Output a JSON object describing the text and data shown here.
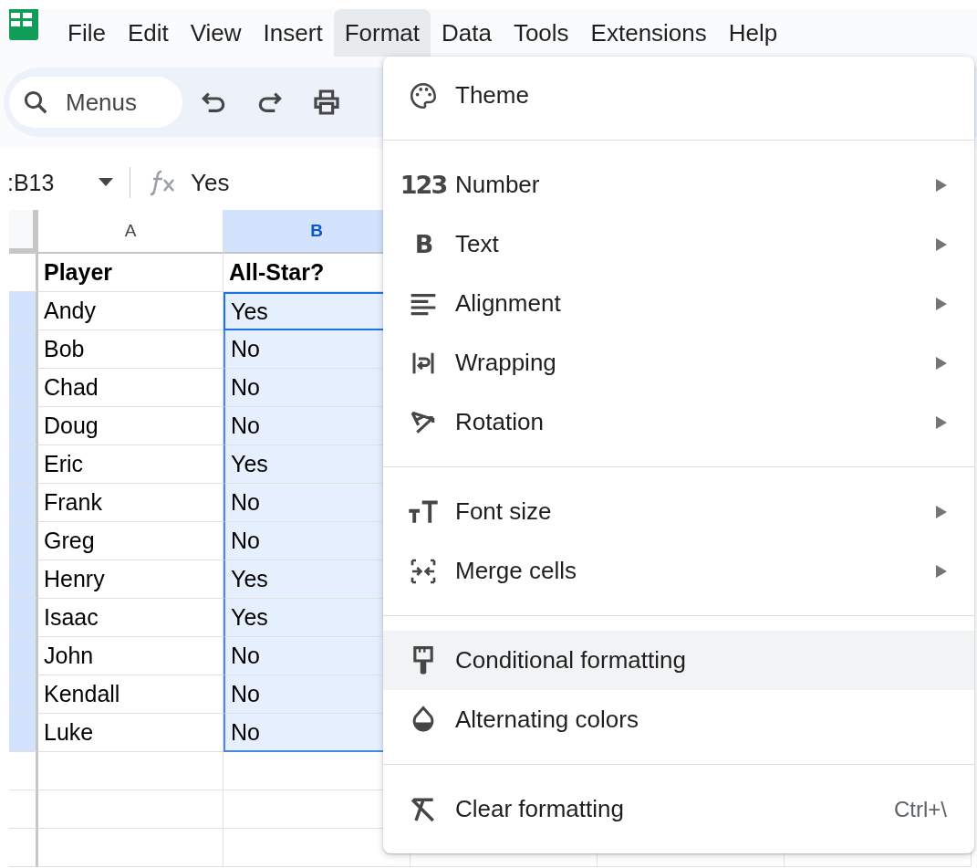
{
  "menubar": {
    "items": [
      {
        "label": "File",
        "selected": false
      },
      {
        "label": "Edit",
        "selected": false
      },
      {
        "label": "View",
        "selected": false
      },
      {
        "label": "Insert",
        "selected": false
      },
      {
        "label": "Format",
        "selected": true
      },
      {
        "label": "Data",
        "selected": false
      },
      {
        "label": "Tools",
        "selected": false
      },
      {
        "label": "Extensions",
        "selected": false
      },
      {
        "label": "Help",
        "selected": false
      }
    ]
  },
  "toolbar": {
    "search": {
      "placeholder": "Menus"
    }
  },
  "formula_bar": {
    "name_box": ":B13",
    "formula": "Yes"
  },
  "grid": {
    "columns": [
      {
        "label": "A",
        "selected": false
      },
      {
        "label": "B",
        "selected": true
      }
    ],
    "rows": [
      {
        "kind": "header",
        "selected": false,
        "active": false,
        "cells": [
          "Player",
          "All-Star?"
        ]
      },
      {
        "kind": "data",
        "selected": true,
        "active": true,
        "cells": [
          "Andy",
          "Yes"
        ]
      },
      {
        "kind": "data",
        "selected": true,
        "active": false,
        "cells": [
          "Bob",
          "No"
        ]
      },
      {
        "kind": "data",
        "selected": true,
        "active": false,
        "cells": [
          "Chad",
          "No"
        ]
      },
      {
        "kind": "data",
        "selected": true,
        "active": false,
        "cells": [
          "Doug",
          "No"
        ]
      },
      {
        "kind": "data",
        "selected": true,
        "active": false,
        "cells": [
          "Eric",
          "Yes"
        ]
      },
      {
        "kind": "data",
        "selected": true,
        "active": false,
        "cells": [
          "Frank",
          "No"
        ]
      },
      {
        "kind": "data",
        "selected": true,
        "active": false,
        "cells": [
          "Greg",
          "No"
        ]
      },
      {
        "kind": "data",
        "selected": true,
        "active": false,
        "cells": [
          "Henry",
          "Yes"
        ]
      },
      {
        "kind": "data",
        "selected": true,
        "active": false,
        "cells": [
          "Isaac",
          "Yes"
        ]
      },
      {
        "kind": "data",
        "selected": true,
        "active": false,
        "cells": [
          "John",
          "No"
        ]
      },
      {
        "kind": "data",
        "selected": true,
        "active": false,
        "cells": [
          "Kendall",
          "No"
        ]
      },
      {
        "kind": "data",
        "selected": true,
        "active": false,
        "cells": [
          "Luke",
          "No"
        ]
      }
    ]
  },
  "format_menu": {
    "items": [
      {
        "kind": "item",
        "label": "Theme",
        "submenu": false,
        "selected": false
      },
      {
        "kind": "separator"
      },
      {
        "kind": "item",
        "label": "Number",
        "glyph": "123",
        "submenu": true,
        "selected": false
      },
      {
        "kind": "item",
        "label": "Text",
        "glyph": "B",
        "submenu": true,
        "selected": false
      },
      {
        "kind": "item",
        "label": "Alignment",
        "submenu": true,
        "selected": false
      },
      {
        "kind": "item",
        "label": "Wrapping",
        "submenu": true,
        "selected": false
      },
      {
        "kind": "item",
        "label": "Rotation",
        "submenu": true,
        "selected": false
      },
      {
        "kind": "separator"
      },
      {
        "kind": "item",
        "label": "Font size",
        "submenu": true,
        "selected": false
      },
      {
        "kind": "item",
        "label": "Merge cells",
        "submenu": true,
        "selected": false
      },
      {
        "kind": "separator"
      },
      {
        "kind": "item",
        "label": "Conditional formatting",
        "submenu": false,
        "selected": true
      },
      {
        "kind": "item",
        "label": "Alternating colors",
        "submenu": false,
        "selected": false
      },
      {
        "kind": "separator"
      },
      {
        "kind": "item",
        "label": "Clear formatting",
        "submenu": false,
        "selected": false,
        "shortcut": "Ctrl+\\"
      }
    ]
  }
}
